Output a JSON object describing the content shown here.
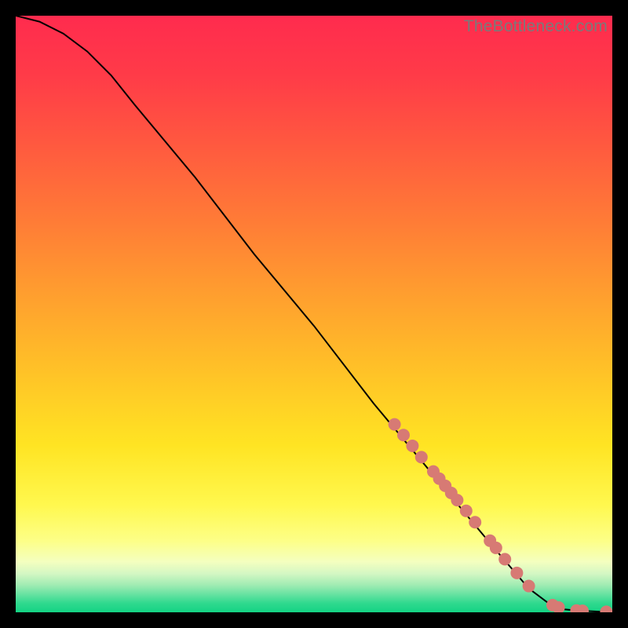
{
  "watermark": "TheBottleneck.com",
  "chart_data": {
    "type": "line",
    "title": "",
    "xlabel": "",
    "ylabel": "",
    "xlim": [
      0,
      100
    ],
    "ylim": [
      0,
      100
    ],
    "grid": false,
    "series": [
      {
        "name": "curve",
        "stroke": "#000000",
        "x": [
          0,
          4,
          8,
          12,
          16,
          20,
          30,
          40,
          50,
          60,
          70,
          80,
          86,
          90,
          92,
          94,
          96,
          98,
          100
        ],
        "y": [
          100,
          99,
          97,
          94,
          90,
          85,
          73,
          60,
          48,
          35,
          23,
          11,
          4,
          1,
          0.5,
          0.3,
          0.2,
          0.1,
          0
        ]
      }
    ],
    "markers": [
      {
        "name": "dots",
        "color": "#d77a74",
        "radius_px": 8,
        "points": [
          {
            "x": 63.5,
            "y": 31.5
          },
          {
            "x": 65.0,
            "y": 29.7
          },
          {
            "x": 66.5,
            "y": 27.9
          },
          {
            "x": 68.0,
            "y": 26.0
          },
          {
            "x": 70.0,
            "y": 23.6
          },
          {
            "x": 71.0,
            "y": 22.4
          },
          {
            "x": 72.0,
            "y": 21.2
          },
          {
            "x": 73.0,
            "y": 20.0
          },
          {
            "x": 74.0,
            "y": 18.8
          },
          {
            "x": 75.5,
            "y": 17.0
          },
          {
            "x": 77.0,
            "y": 15.1
          },
          {
            "x": 79.5,
            "y": 12.0
          },
          {
            "x": 80.5,
            "y": 10.8
          },
          {
            "x": 82.0,
            "y": 8.9
          },
          {
            "x": 84.0,
            "y": 6.6
          },
          {
            "x": 86.0,
            "y": 4.4
          },
          {
            "x": 90.0,
            "y": 1.2
          },
          {
            "x": 91.0,
            "y": 0.8
          },
          {
            "x": 94.0,
            "y": 0.3
          },
          {
            "x": 95.0,
            "y": 0.25
          },
          {
            "x": 99.0,
            "y": 0.08
          }
        ]
      }
    ],
    "background_gradient": {
      "stops": [
        {
          "offset": 0.0,
          "color": "#ff2b4e"
        },
        {
          "offset": 0.1,
          "color": "#ff3b48"
        },
        {
          "offset": 0.22,
          "color": "#ff5a3f"
        },
        {
          "offset": 0.35,
          "color": "#ff7d36"
        },
        {
          "offset": 0.48,
          "color": "#ffa22e"
        },
        {
          "offset": 0.6,
          "color": "#ffc327"
        },
        {
          "offset": 0.72,
          "color": "#ffe423"
        },
        {
          "offset": 0.82,
          "color": "#fff84e"
        },
        {
          "offset": 0.88,
          "color": "#fdff87"
        },
        {
          "offset": 0.915,
          "color": "#f4ffbf"
        },
        {
          "offset": 0.935,
          "color": "#d4f7c3"
        },
        {
          "offset": 0.955,
          "color": "#9eebb2"
        },
        {
          "offset": 0.972,
          "color": "#5fe19f"
        },
        {
          "offset": 0.985,
          "color": "#2fd98e"
        },
        {
          "offset": 1.0,
          "color": "#14d384"
        }
      ]
    }
  }
}
